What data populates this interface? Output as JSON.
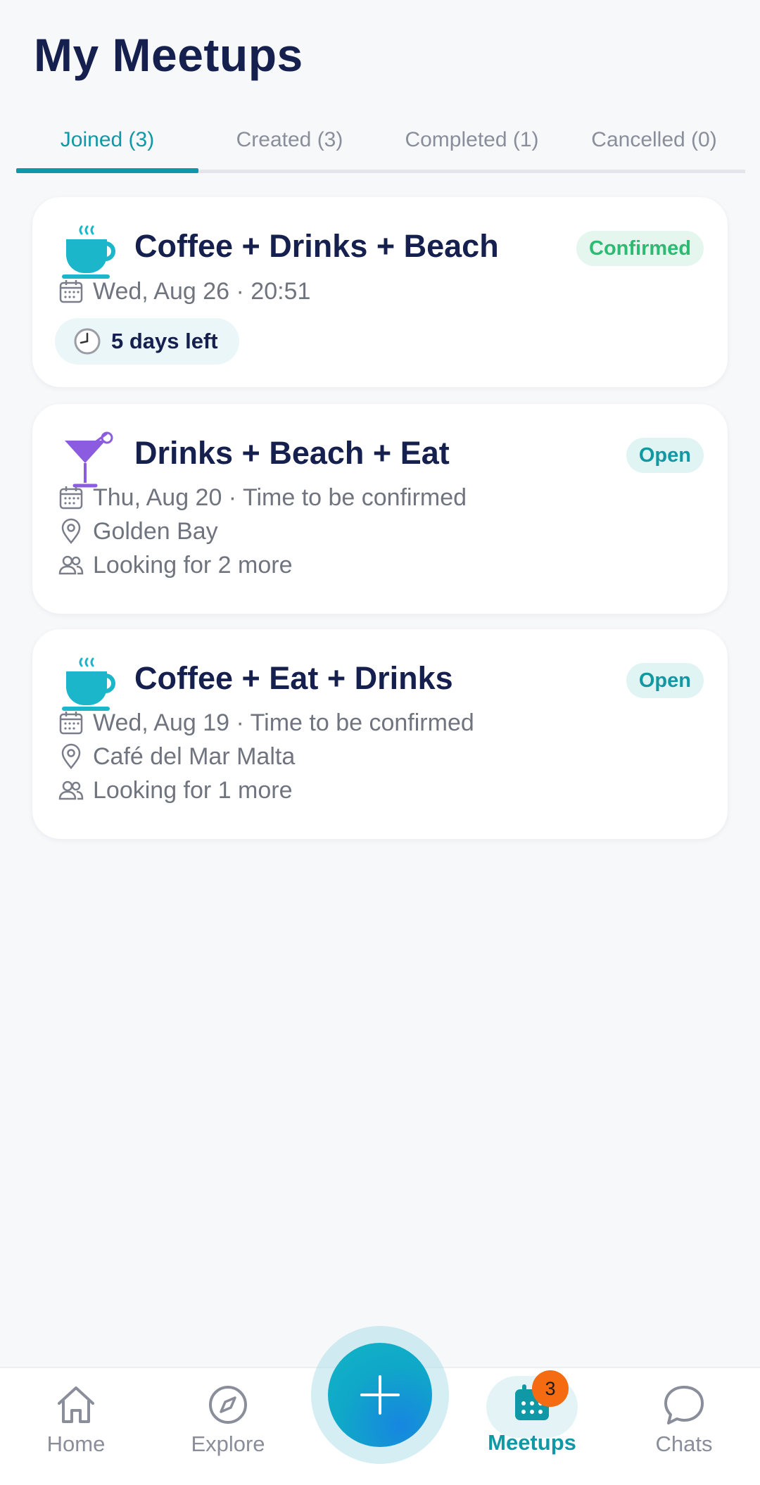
{
  "header": {
    "title": "My Meetups"
  },
  "tabs": [
    {
      "label": "Joined (3)",
      "active": true
    },
    {
      "label": "Created (3)",
      "active": false
    },
    {
      "label": "Completed (1)",
      "active": false
    },
    {
      "label": "Cancelled (0)",
      "active": false
    }
  ],
  "meetups": [
    {
      "icon": "coffee-cup-icon",
      "title": "Coffee + Drinks + Beach",
      "status": "Confirmed",
      "date": "Wed, Aug 26 · 20:51",
      "countdown": "5 days left"
    },
    {
      "icon": "cocktail-icon",
      "title": "Drinks + Beach + Eat",
      "status": "Open",
      "date": "Thu, Aug 20 · Time to be confirmed",
      "location": "Golden Bay",
      "looking_for": "Looking for 2 more"
    },
    {
      "icon": "coffee-cup-icon",
      "title": "Coffee + Eat + Drinks",
      "status": "Open",
      "date": "Wed, Aug 19 · Time to be confirmed",
      "location": "Café del Mar Malta",
      "looking_for": "Looking for 1 more"
    }
  ],
  "nav": {
    "home": "Home",
    "explore": "Explore",
    "meetups": "Meetups",
    "meetups_badge": "3",
    "chats": "Chats",
    "active": "meetups"
  },
  "colors": {
    "accent": "#1098a6",
    "confirmed": "#2bbb73",
    "badge": "#f46b12",
    "title": "#16204e"
  }
}
